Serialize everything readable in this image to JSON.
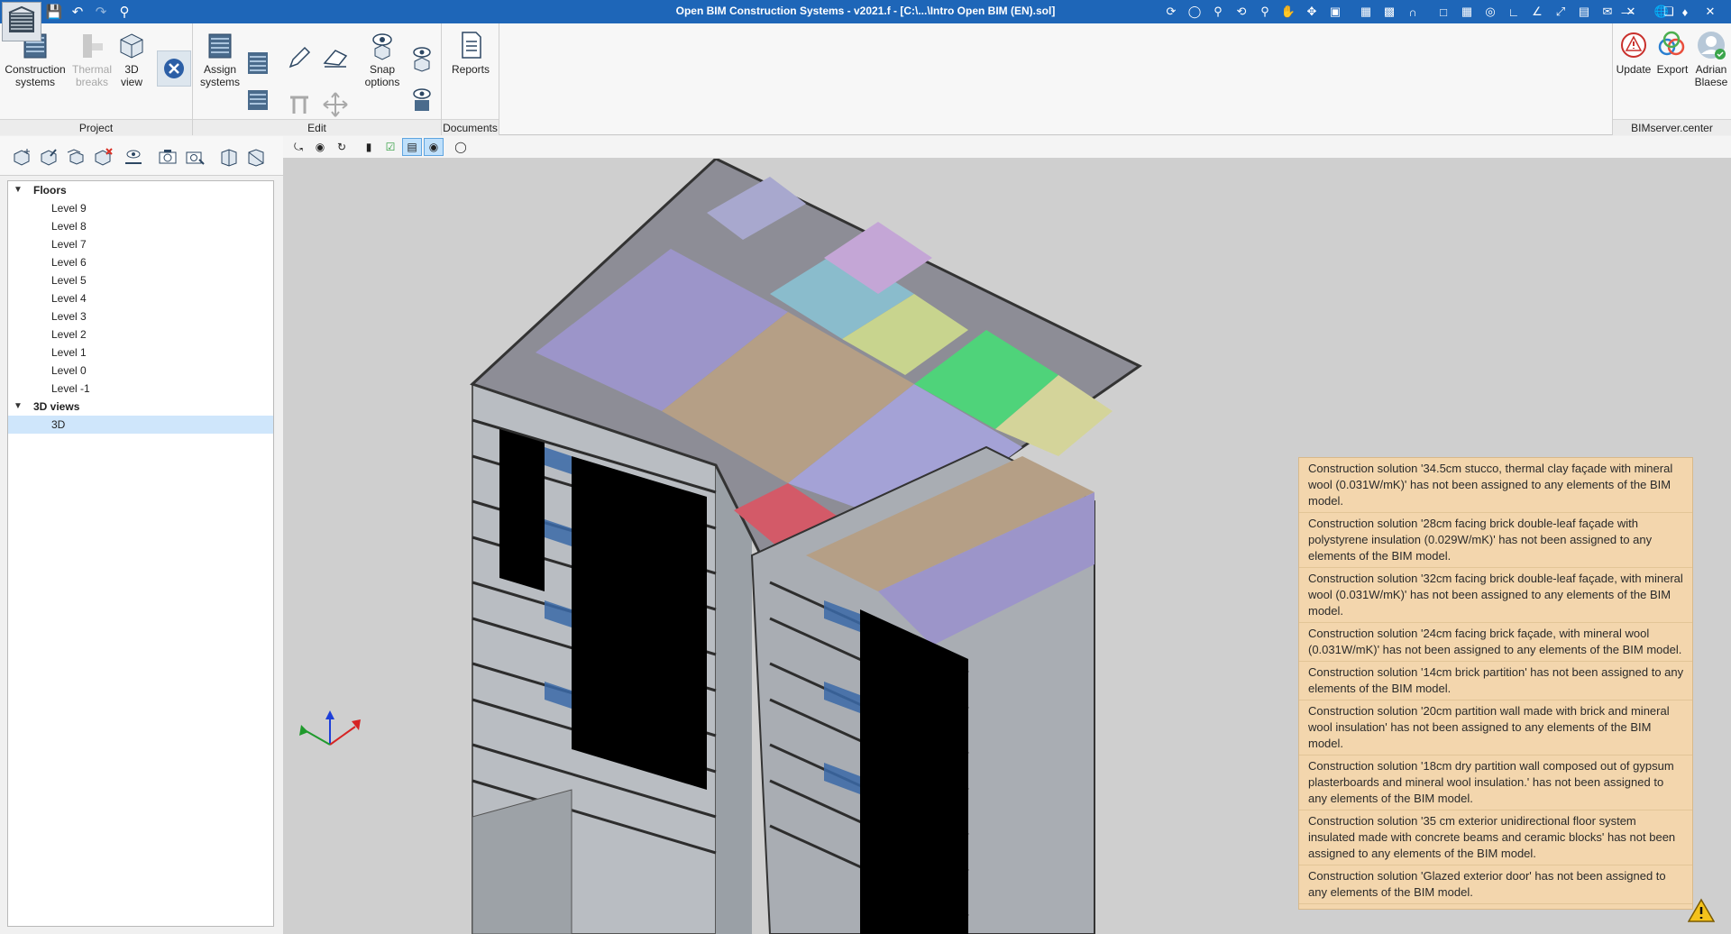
{
  "window": {
    "title": "Open BIM Construction Systems - v2021.f - [C:\\...\\Intro Open BIM (EN).sol]"
  },
  "ribbon": {
    "project": {
      "label": "Project",
      "construction_systems": [
        "Construction",
        "systems"
      ],
      "thermal_breaks": [
        "Thermal",
        "breaks"
      ],
      "view_3d": [
        "3D",
        "view"
      ]
    },
    "edit": {
      "label": "Edit",
      "assign_systems": [
        "Assign",
        "systems"
      ],
      "snap_options": [
        "Snap",
        "options"
      ]
    },
    "documents": {
      "label": "Documents",
      "reports": "Reports"
    },
    "bimserver": {
      "label": "BIMserver.center",
      "update": "Update",
      "export": "Export",
      "user": [
        "Adrian",
        "Blaese"
      ]
    }
  },
  "tree": {
    "floors_label": "Floors",
    "levels": [
      "Level 9",
      "Level 8",
      "Level 7",
      "Level 6",
      "Level 5",
      "Level 4",
      "Level 3",
      "Level 2",
      "Level 1",
      "Level 0",
      "Level -1"
    ],
    "views_label": "3D views",
    "views": [
      "3D"
    ],
    "selected_view": "3D"
  },
  "warnings": [
    "Construction solution '34.5cm stucco, thermal clay façade with mineral wool (0.031W/mK)' has not been assigned to any elements of the BIM model.",
    "Construction solution '28cm facing brick double-leaf façade with polystyrene insulation (0.029W/mK)' has not been assigned to any elements of the BIM model.",
    "Construction solution '32cm facing brick double-leaf façade, with mineral wool (0.031W/mK)' has not been assigned to any elements of the BIM model.",
    "Construction solution '24cm facing brick façade, with mineral wool (0.031W/mK)' has not been assigned to any elements of the BIM model.",
    "Construction solution '14cm brick partition' has not been assigned to any elements of the BIM model.",
    "Construction solution '20cm partition wall made with brick and mineral wool insulation' has not been assigned to any elements of the BIM model.",
    "Construction solution '18cm dry partition wall composed out of gypsum plasterboards and mineral wool insulation.' has not been assigned to any elements of the BIM model.",
    "Construction solution '35 cm exterior unidirectional floor system insulated made with concrete beams and ceramic blocks' has not been assigned to any elements of the BIM model.",
    "Construction solution 'Glazed exterior door' has not been assigned to any elements of the BIM model."
  ],
  "colors": {
    "titlebar": "#1e66b8",
    "warning_panel": "#f3d6ad",
    "selected_row": "#cfe6fb",
    "viewport_bg": "#cfcfcf"
  }
}
